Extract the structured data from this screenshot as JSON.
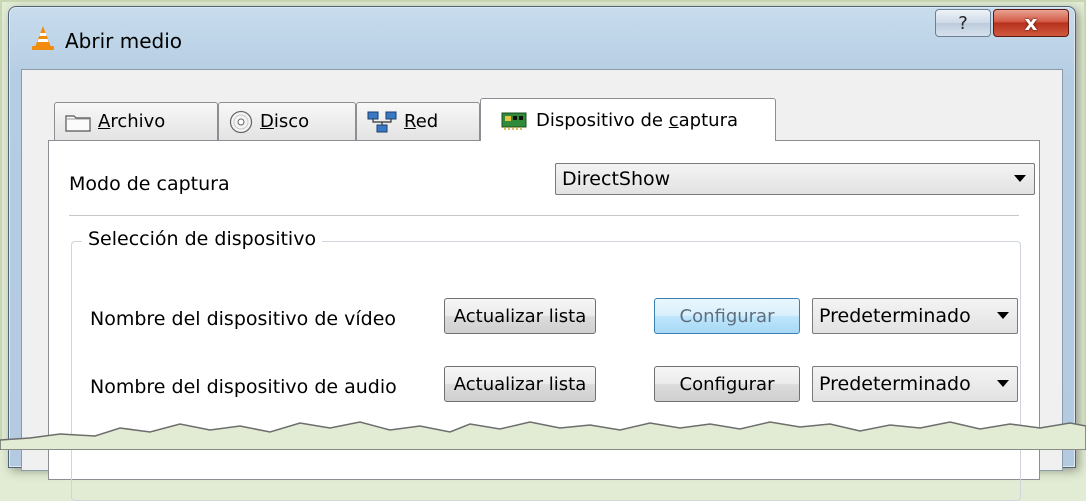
{
  "window": {
    "title": "Abrir medio",
    "help_symbol": "?",
    "close_symbol": "x"
  },
  "tabs": [
    {
      "label_pre": "",
      "label_u": "A",
      "label_post": "rchivo",
      "icon": "folder-icon"
    },
    {
      "label_pre": "",
      "label_u": "D",
      "label_post": "isco",
      "icon": "disc-icon"
    },
    {
      "label_pre": "",
      "label_u": "R",
      "label_post": "ed",
      "icon": "network-icon"
    },
    {
      "label_pre": "Dispositivo de ",
      "label_u": "c",
      "label_post": "aptura",
      "icon": "capture-card-icon",
      "active": true
    }
  ],
  "capture": {
    "mode_label": "Modo de captura",
    "mode_value": "DirectShow"
  },
  "device_group": {
    "title": "Selección de dispositivo",
    "video_label": "Nombre del dispositivo de vídeo",
    "audio_label": "Nombre del dispositivo de audio",
    "refresh_label": "Actualizar lista",
    "configure_label": "Configurar",
    "video_device": "Predeterminado",
    "audio_device": "Predeterminado"
  },
  "colors": {
    "close_button": "#c8412a",
    "frame": "#b9cfe4",
    "background": "#e2ecd4"
  }
}
